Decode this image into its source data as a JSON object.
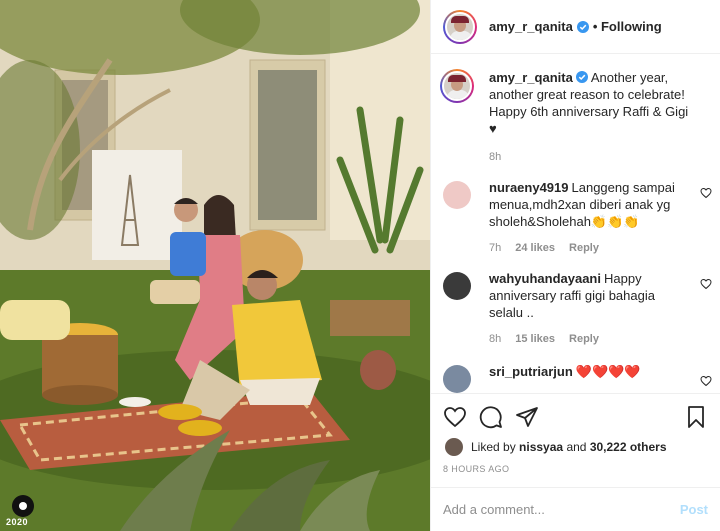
{
  "post": {
    "username": "amy_r_qanita",
    "follow_state": "• Following",
    "photo_watermark": "2020"
  },
  "caption": {
    "user": "amy_r_qanita",
    "text": "Another year, another great reason to celebrate! Happy 6th anniversary Raffi & Gigi ♥",
    "time": "8h"
  },
  "comments": [
    {
      "user": "nuraeny4919",
      "text": "Langgeng sampai menua,mdh2xan diberi anak yg sholeh&Sholehah👏👏👏",
      "time": "7h",
      "likes": "24 likes",
      "reply": "Reply",
      "avatar_color": "#e8b7b7"
    },
    {
      "user": "wahyuhandayaani",
      "text": "Happy anniversary raffi gigi bahagia selalu ..",
      "time": "8h",
      "likes": "15 likes",
      "reply": "Reply",
      "avatar_color": "#3a3a3a"
    },
    {
      "user": "sri_putriarjun",
      "text": "❤️❤️❤️❤️",
      "time": "",
      "likes": "",
      "reply": "",
      "avatar_color": "#7a8aa0"
    }
  ],
  "likes_summary": {
    "prefix": "Liked by ",
    "user": "nissyaa",
    "middle": " and ",
    "count": "30,222 others"
  },
  "time_ago": "8 HOURS AGO",
  "comment_box": {
    "placeholder": "Add a comment...",
    "post_label": "Post"
  },
  "icons": {
    "verified": "verified-badge-icon",
    "like": "heart-icon",
    "comment": "comment-bubble-icon",
    "share": "paper-plane-icon",
    "save": "bookmark-icon"
  },
  "colors": {
    "verified_blue": "#3897f0",
    "post_button_disabled": "#b2dffc",
    "heart_red": "#ed4956"
  }
}
